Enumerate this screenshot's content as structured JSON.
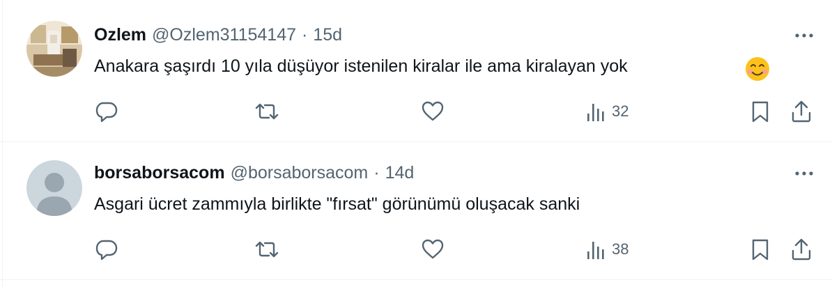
{
  "tweets": [
    {
      "name": "Ozlem",
      "handle": "@Ozlem31154147",
      "separator": "·",
      "time": "15d",
      "text": "Anakara şaşırdı 10 yıla düşüyor istenilen kiralar ile ama kiralayan yok",
      "emoji": "smiling-face-with-smiling-eyes",
      "views": "32",
      "avatar_type": "photo"
    },
    {
      "name": "borsaborsacom",
      "handle": "@borsaborsacom",
      "separator": "·",
      "time": "14d",
      "text": "Asgari ücret zammıyla birlikte \"fırsat\" görünümü oluşacak sanki",
      "views": "38",
      "avatar_type": "default-silhouette"
    }
  ],
  "colors": {
    "text": "#0f1419",
    "secondary": "#536471",
    "divider": "#eff3f4",
    "default_avatar_bg": "#ccd6dd",
    "default_avatar_figure": "#9aa6b0"
  },
  "icons": {
    "reply": "reply-icon",
    "retweet": "retweet-icon",
    "like": "heart-icon",
    "views": "views-icon",
    "bookmark": "bookmark-icon",
    "share": "share-icon",
    "more": "more-icon"
  }
}
